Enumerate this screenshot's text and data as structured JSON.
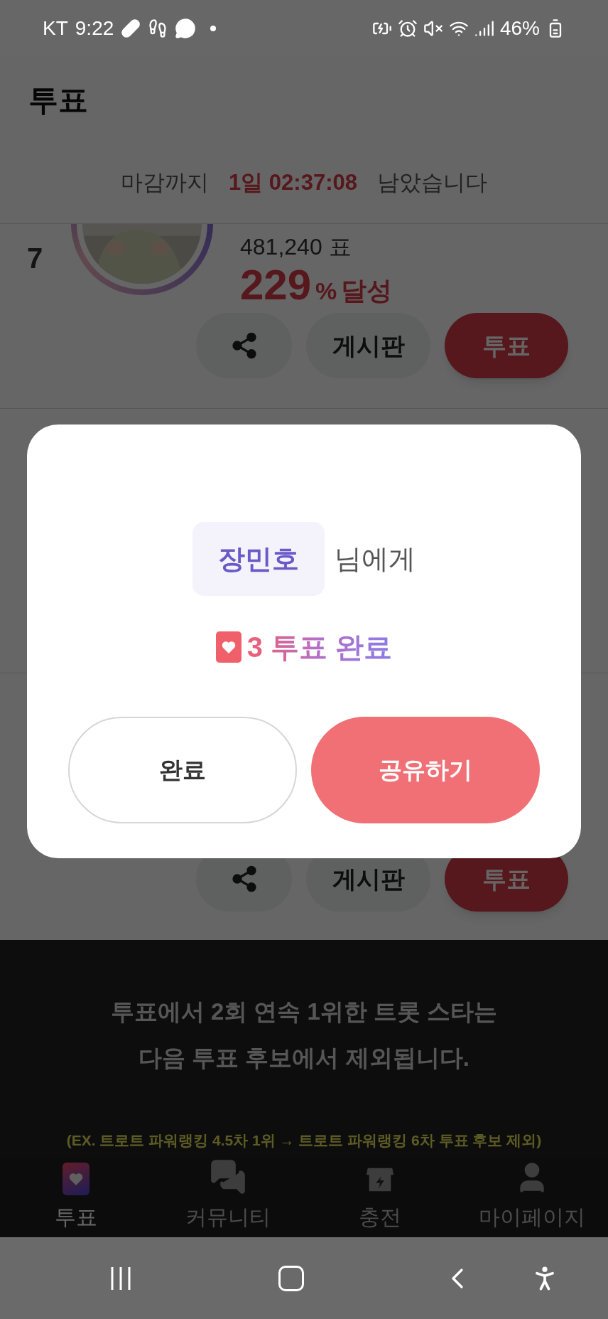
{
  "status_bar": {
    "carrier": "KT",
    "time": "9:22",
    "battery": "46%"
  },
  "header": {
    "title": "투표"
  },
  "countdown": {
    "prefix": "마감까지",
    "time": "1일 02:37:08",
    "suffix": "남았습니다"
  },
  "candidates": [
    {
      "rank": "7",
      "votes": "481,240 표",
      "percent": "229",
      "percent_unit": "%",
      "achieved": "달성",
      "board_button": "게시판",
      "vote_button": "투표"
    },
    {
      "board_button": "게시판",
      "vote_button": "투표"
    }
  ],
  "dialog": {
    "name": "장민호",
    "name_suffix": "님에게",
    "result": "3 투표 완료",
    "buttons": [
      {
        "label": "완료",
        "kind": "secondary"
      },
      {
        "label": "공유하기",
        "kind": "primary"
      }
    ]
  },
  "notice": {
    "lines": [
      "투표에서 2회 연속 1위한 트롯 스타는",
      "다음 투표 후보에서 제외됩니다."
    ],
    "example": "(EX. 트로트 파워랭킹 4.5차 1위 → 트로트 파워랭킹 6차 투표 후보 제외)"
  },
  "bottom_nav": [
    {
      "label": "투표",
      "kind": "vote",
      "selected": true
    },
    {
      "label": "커뮤니티",
      "kind": "community",
      "selected": false
    },
    {
      "label": "충전",
      "kind": "charge",
      "selected": false
    },
    {
      "label": "마이페이지",
      "kind": "mypage",
      "selected": false
    }
  ]
}
